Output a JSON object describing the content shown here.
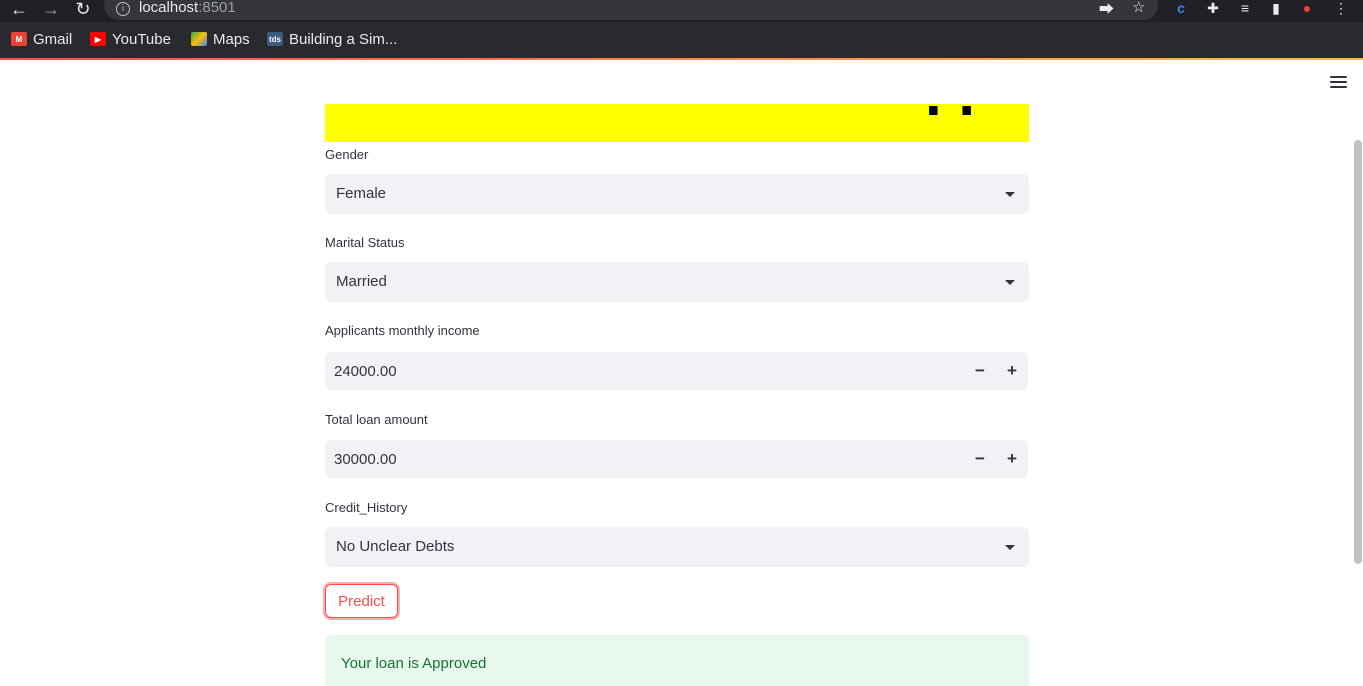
{
  "browser": {
    "url_host": "localhost",
    "url_port": ":8501",
    "bookmarks": [
      {
        "label": "Gmail",
        "icon": "gmail-icon"
      },
      {
        "label": "YouTube",
        "icon": "youtube-icon"
      },
      {
        "label": "Maps",
        "icon": "maps-icon"
      },
      {
        "label": "Building a Sim...",
        "icon": "tds-icon",
        "icon_text": "tds"
      }
    ]
  },
  "form": {
    "gender": {
      "label": "Gender",
      "value": "Female"
    },
    "marital_status": {
      "label": "Marital Status",
      "value": "Married"
    },
    "income": {
      "label": "Applicants monthly income",
      "value": "24000.00",
      "minus": "−",
      "plus": "+"
    },
    "loan_amount": {
      "label": "Total loan amount",
      "value": "30000.00",
      "minus": "−",
      "plus": "+"
    },
    "credit_history": {
      "label": "Credit_History",
      "value": "No Unclear Debts"
    },
    "predict_label": "Predict",
    "result": "Your loan is Approved"
  },
  "colors": {
    "accent": "#ff4b4b",
    "banner": "#ffff00",
    "success_bg": "#e8f8ed",
    "success_text": "#177233"
  }
}
